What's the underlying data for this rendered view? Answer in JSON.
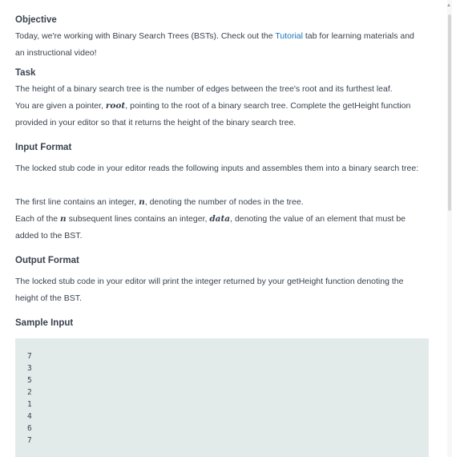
{
  "objective": {
    "heading": "Objective",
    "text_before_link": "Today, we're working with Binary Search Trees (BSTs). Check out the ",
    "link_label": "Tutorial",
    "text_after_link": " tab for learning materials and an instructional video!"
  },
  "task": {
    "heading": "Task",
    "line1": "The height of a binary search tree is the number of edges between the tree's root and its furthest leaf.",
    "line2_before": "You are given a pointer, ",
    "line2_var": "root",
    "line2_after": ", pointing to the root of a binary search tree. Complete the getHeight function provided in your editor so that it returns the height of the binary search tree."
  },
  "input_format": {
    "heading": "Input Format",
    "para1": "The locked stub code in your editor reads the following inputs and assembles them into a binary search tree:",
    "para2_before": "The first line contains an integer, ",
    "para2_var": "n",
    "para2_after": ", denoting the number of nodes in the tree.",
    "para3_before": "Each of the ",
    "para3_var": "n",
    "para3_mid": " subsequent lines contains an integer, ",
    "para3_var2": "data",
    "para3_after": ", denoting the value of an element that must be added to the BST."
  },
  "output_format": {
    "heading": "Output Format",
    "para": "The locked stub code in your editor will print the integer returned by your getHeight function denoting the height of the BST."
  },
  "sample_input": {
    "heading": "Sample Input",
    "lines": [
      "7",
      "3",
      "5",
      "2",
      "1",
      "4",
      "6",
      "7"
    ]
  }
}
